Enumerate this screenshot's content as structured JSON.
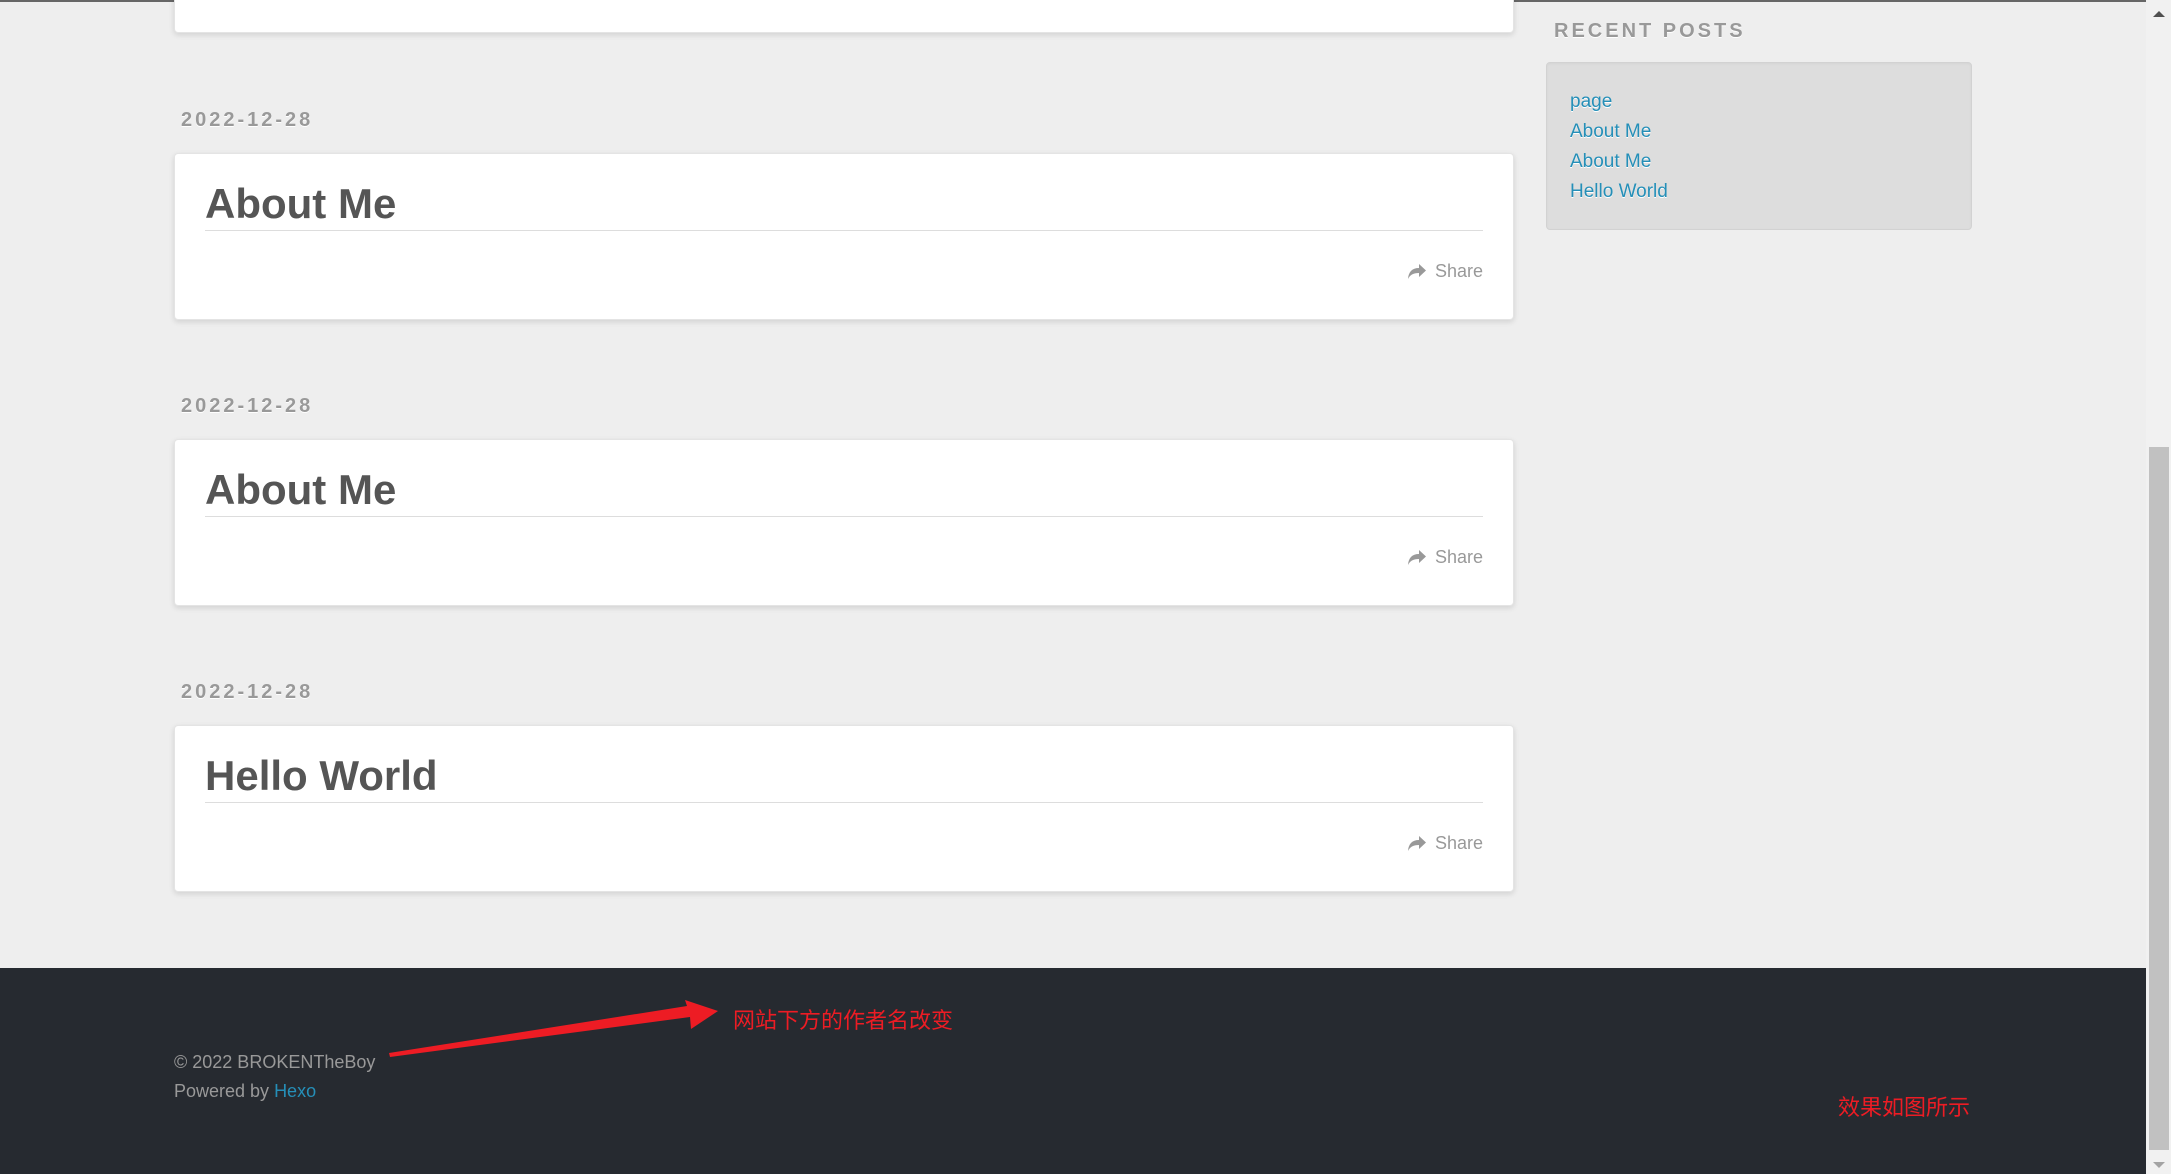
{
  "posts": [
    {
      "date": "2022-12-28",
      "title": "About Me",
      "share_label": "Share"
    },
    {
      "date": "2022-12-28",
      "title": "About Me",
      "share_label": "Share"
    },
    {
      "date": "2022-12-28",
      "title": "Hello World",
      "share_label": "Share"
    }
  ],
  "sidebar": {
    "widget_title": "RECENT POSTS",
    "recent_posts": [
      "page",
      "About Me",
      "About Me",
      "Hello World"
    ]
  },
  "footer": {
    "copyright": "© 2022 BROKENTheBoy",
    "powered_by_prefix": "Powered by ",
    "powered_by_link": "Hexo"
  },
  "annotations": {
    "arrow_note": "网站下方的作者名改变",
    "result_note": "效果如图所示",
    "color": "#ed1c24"
  },
  "colors": {
    "link": "#258fb8",
    "footer_bg": "#262a30",
    "page_bg": "#eeeeee"
  }
}
